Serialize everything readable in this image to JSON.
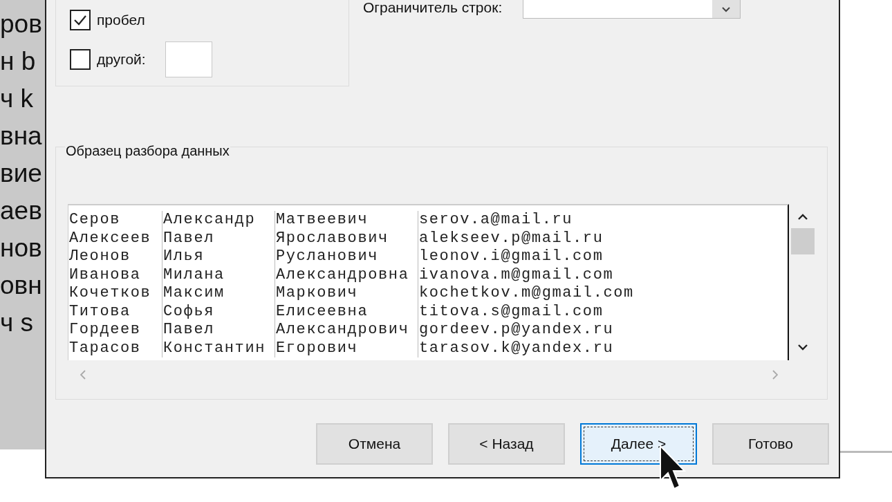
{
  "background_sheet": {
    "fragments": [
      "ров",
      "н b",
      "ч k",
      "вна",
      "вие",
      "аев",
      "нов",
      "овн",
      "ч s"
    ]
  },
  "delimiters": [
    {
      "kind": "checkbox",
      "label": "пробел",
      "checked": true
    },
    {
      "kind": "checkbox_with_field",
      "label": "другой:",
      "checked": false
    }
  ],
  "line_delimiter": {
    "label": "Ограничитель строк:"
  },
  "preview": {
    "title": "Образец разбора данных",
    "rows": [
      [
        "Серов",
        "Александр",
        "Матвеевич",
        "serov.a@mail.ru"
      ],
      [
        "Алексеев",
        "Павел",
        "Ярославович",
        "alekseev.p@mail.ru"
      ],
      [
        "Леонов",
        "Илья",
        "Русланович",
        "leonov.i@gmail.com"
      ],
      [
        "Иванова",
        "Милана",
        "Александровна",
        "ivanova.m@gmail.com"
      ],
      [
        "Кочетков",
        "Максим",
        "Маркович",
        "kochetkov.m@gmail.com"
      ],
      [
        "Титова",
        "Софья",
        "Елисеевна",
        "titova.s@gmail.com"
      ],
      [
        "Гордеев",
        "Павел",
        "Александрович",
        "gordeev.p@yandex.ru"
      ],
      [
        "Тарасов",
        "Константин",
        "Егорович",
        "tarasov.k@yandex.ru"
      ]
    ]
  },
  "buttons": [
    {
      "label": "Отмена",
      "focused": false
    },
    {
      "label": "< Назад",
      "focused": false
    },
    {
      "label": "Далее >",
      "focused": true
    },
    {
      "label": "Готово",
      "focused": false
    }
  ]
}
